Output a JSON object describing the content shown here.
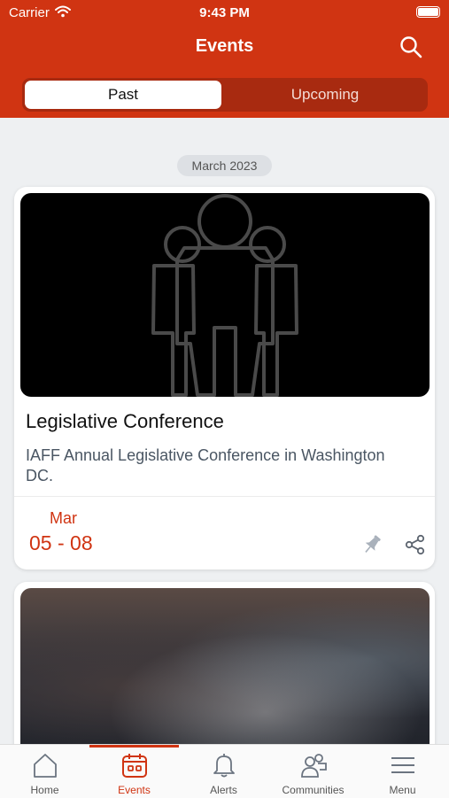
{
  "status_bar": {
    "carrier": "Carrier",
    "time": "9:43 PM"
  },
  "header": {
    "title": "Events",
    "search_icon": "search-icon"
  },
  "segmented": {
    "past": "Past",
    "upcoming": "Upcoming",
    "selected": "Past"
  },
  "month_label": "March 2023",
  "events": [
    {
      "title": "Legislative Conference",
      "description": "IAFF Annual Legislative Conference in Washington DC.",
      "date_month": "Mar",
      "date_range": "05 - 08"
    }
  ],
  "tabbar": {
    "active": "Events",
    "items": [
      {
        "label": "Home",
        "icon": "home-icon"
      },
      {
        "label": "Events",
        "icon": "calendar-icon"
      },
      {
        "label": "Alerts",
        "icon": "bell-icon"
      },
      {
        "label": "Communities",
        "icon": "people-icon"
      },
      {
        "label": "Menu",
        "icon": "menu-icon"
      }
    ]
  },
  "colors": {
    "accent": "#d03412",
    "background": "#eef0f2",
    "segment_track": "#a82a10"
  }
}
